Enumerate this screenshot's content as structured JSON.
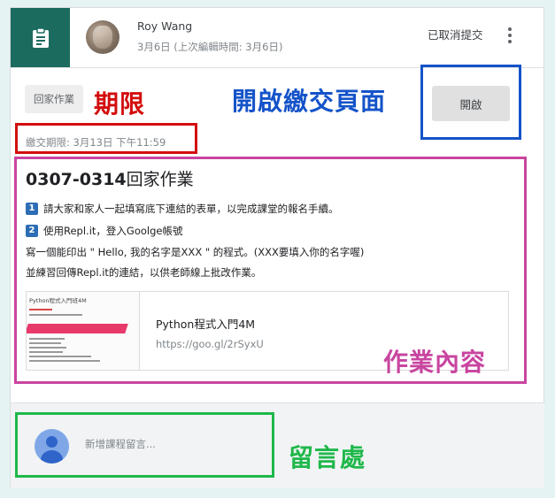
{
  "header": {
    "author_name": "Roy Wang",
    "dates": "3月6日 (上次編輯時間: 3月6日)",
    "status": "已取消提交",
    "icons": {
      "assignment": "clipboard-icon",
      "more": "more-vert-icon"
    }
  },
  "assignment": {
    "type_chip": "回家作業",
    "deadline": "繳交期限: 3月13日 下午11:59",
    "open_button": "開啟",
    "title_bold": "0307-0314",
    "title_rest": "回家作業",
    "lines": {
      "l1_num": "1",
      "l1_text": "請大家和家人一起填寫底下連結的表單，以完成課堂的報名手續。",
      "l2_num": "2",
      "l2_text": "使用Repl.it，登入Goolge帳號",
      "l3_text": "寫一個能印出 \" Hello, 我的名字是XXX \" 的程式。(XXX要填入你的名字喔)",
      "l4_text": "並練習回傳Repl.it的連結，以供老師線上批改作業。"
    },
    "attachment": {
      "thumb_title": "Python程式入門班4M",
      "title": "Python程式入門4M",
      "url": "https://goo.gl/2rSyxU"
    }
  },
  "comment": {
    "placeholder": "新增課程留言..."
  },
  "annotations": {
    "deadline_label": "期限",
    "open_label": "開啟繳交頁面",
    "content_label": "作業內容",
    "comment_label": "留言處",
    "colors": {
      "red": "#d30d0d",
      "blue": "#1453c9",
      "pink": "#c945a0",
      "green": "#1eb84a"
    }
  },
  "colors": {
    "tile": "#1b6b5f",
    "badge": "#2d6db5"
  }
}
